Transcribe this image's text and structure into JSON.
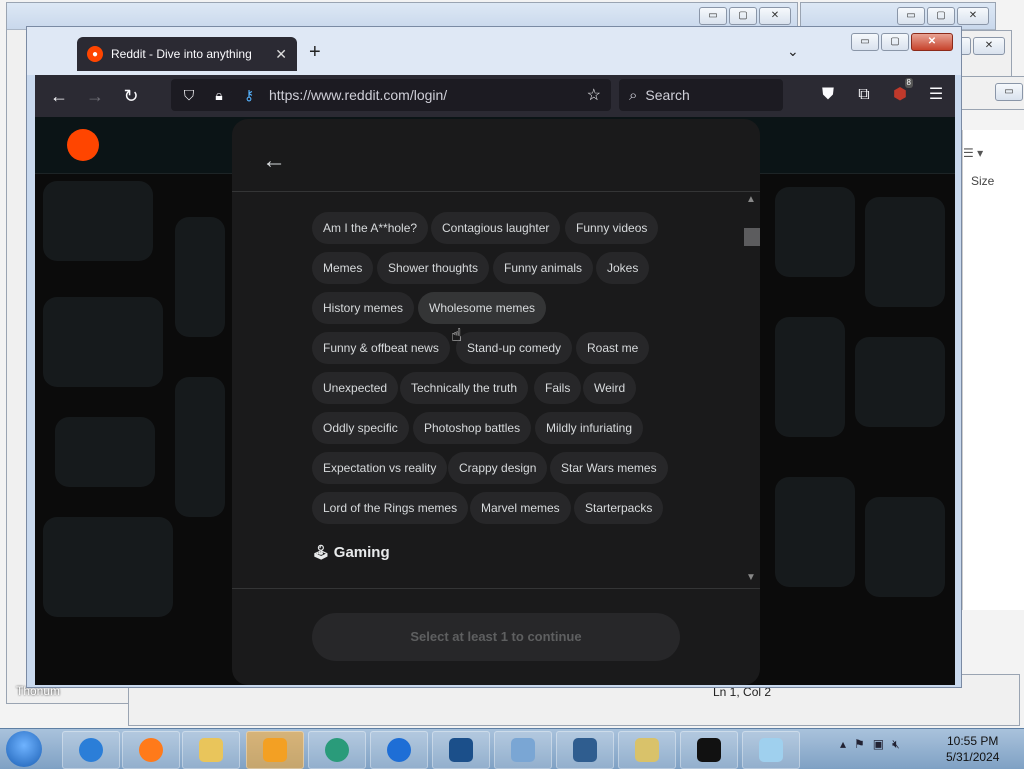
{
  "browser": {
    "tab_title": "Reddit - Dive into anything",
    "url": "https://www.reddit.com/login/",
    "search_placeholder": "Search",
    "ublock_count": "8"
  },
  "modal": {
    "chips": [
      {
        "label": "Am I the A**hole?"
      },
      {
        "label": "Contagious laughter"
      },
      {
        "label": "Funny videos"
      },
      {
        "label": "Memes"
      },
      {
        "label": "Shower thoughts"
      },
      {
        "label": "Funny animals"
      },
      {
        "label": "Jokes"
      },
      {
        "label": "History memes"
      },
      {
        "label": "Wholesome memes"
      },
      {
        "label": "Funny & offbeat news"
      },
      {
        "label": "Stand-up comedy"
      },
      {
        "label": "Roast me"
      },
      {
        "label": "Unexpected"
      },
      {
        "label": "Technically the truth"
      },
      {
        "label": "Fails"
      },
      {
        "label": "Weird"
      },
      {
        "label": "Oddly specific"
      },
      {
        "label": "Photoshop battles"
      },
      {
        "label": "Mildly infuriating"
      },
      {
        "label": "Expectation vs reality"
      },
      {
        "label": "Crappy design"
      },
      {
        "label": "Star Wars memes"
      },
      {
        "label": "Lord of the Rings memes"
      },
      {
        "label": "Marvel memes"
      },
      {
        "label": "Starterpacks"
      }
    ],
    "section_heading": "Gaming",
    "continue_label": "Select at least 1 to continue"
  },
  "desktop": {
    "icon_label": "Thonum",
    "right_panel_label": "Size",
    "notepad_status": "Ln 1, Col 2"
  },
  "taskbar": {
    "time": "10:55 PM",
    "date": "5/31/2024"
  },
  "colors": {
    "reddit_orange": "#ff4500",
    "modal_bg": "#1a1a1b",
    "chip_bg": "#272729"
  }
}
